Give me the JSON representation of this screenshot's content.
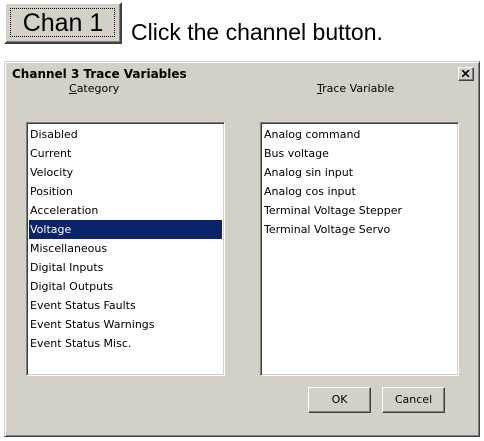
{
  "top": {
    "chan_button_label": "Chan 1",
    "instruction": "Click the channel button."
  },
  "dialog": {
    "title": "Channel 3 Trace Variables",
    "close_icon": "close-icon",
    "category_header_mnemonic": "C",
    "category_header_rest": "ategory",
    "trace_header_mnemonic": "T",
    "trace_header_rest": "race Variable",
    "categories": [
      "Disabled",
      "Current",
      "Velocity",
      "Position",
      "Acceleration",
      "Voltage",
      "Miscellaneous",
      "Digital Inputs",
      "Digital Outputs",
      "Event Status Faults",
      "Event Status Warnings",
      "Event Status Misc."
    ],
    "selected_category_index": 5,
    "trace_variables": [
      "Analog command",
      "Bus voltage",
      "Analog sin input",
      "Analog cos input",
      "Terminal Voltage Stepper",
      "Terminal Voltage Servo"
    ],
    "ok_label": "OK",
    "cancel_label": "Cancel"
  },
  "colors": {
    "face": "#d4d0c8",
    "selection": "#0a246a"
  }
}
